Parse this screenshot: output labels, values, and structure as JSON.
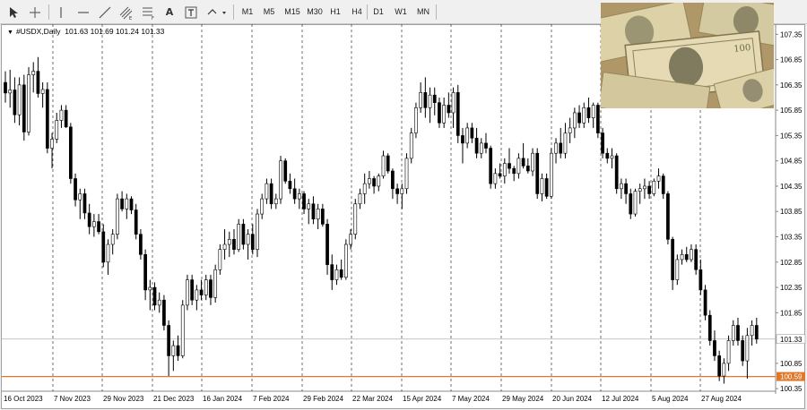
{
  "toolbar": {
    "tools": [
      "cursor-icon",
      "crosshair-icon",
      "vertical-line-icon",
      "horizontal-line-icon",
      "trend-line-icon",
      "channel-icon",
      "fibonacci-icon",
      "text-icon",
      "text-label-icon",
      "arrows-icon"
    ],
    "text_tool_label": "A",
    "timeframes": [
      "M1",
      "M5",
      "M15",
      "M30",
      "H1",
      "H4",
      "D1",
      "W1",
      "MN"
    ]
  },
  "chart_header": {
    "symbol": "#USDX,Daily",
    "ohlc": "101.63 101.69 101.24 101.33"
  },
  "chart_data": {
    "type": "candlestick",
    "symbol": "#USDX",
    "timeframe": "Daily",
    "y_ticks": [
      "107.35",
      "106.85",
      "106.35",
      "105.85",
      "105.35",
      "104.85",
      "104.35",
      "103.85",
      "103.35",
      "102.85",
      "102.35",
      "101.85",
      "101.33",
      "100.85",
      "100.59",
      "100.35"
    ],
    "x_tick_labels": [
      "16 Oct 2023",
      "7 Nov 2023",
      "29 Nov 2023",
      "21 Dec 2023",
      "16 Jan 2024",
      "7 Feb 2024",
      "29 Feb 2024",
      "22 Mar 2024",
      "15 Apr 2024",
      "7 May 2024",
      "29 May 2024",
      "20 Jun 2024",
      "12 Jul 2024",
      "5 Aug 2024",
      "27 Aug 2024"
    ],
    "ylim": [
      100.3,
      107.55
    ],
    "current_price": 101.33,
    "support_level": 100.59,
    "colors": {
      "bull": "#ffffff",
      "bear": "#000000",
      "support": "#e0782a",
      "current": "#b0b0b0",
      "price_tag": "#e0782a"
    },
    "grid": "vertical dashed at date labels",
    "candles": [
      [
        106.4,
        106.62,
        106.0,
        106.19
      ],
      [
        106.19,
        106.65,
        105.9,
        106.25
      ],
      [
        106.25,
        106.5,
        105.6,
        105.76
      ],
      [
        105.76,
        106.5,
        105.55,
        106.35
      ],
      [
        106.35,
        106.55,
        105.25,
        105.42
      ],
      [
        105.42,
        106.7,
        105.35,
        106.55
      ],
      [
        106.55,
        106.8,
        106.2,
        106.62
      ],
      [
        106.62,
        106.9,
        106.1,
        106.18
      ],
      [
        106.18,
        106.4,
        105.9,
        106.26
      ],
      [
        106.26,
        106.4,
        105.0,
        105.1
      ],
      [
        105.1,
        105.4,
        104.7,
        105.28
      ],
      [
        105.28,
        105.8,
        105.2,
        105.65
      ],
      [
        105.65,
        105.95,
        105.5,
        105.85
      ],
      [
        105.85,
        105.95,
        105.5,
        105.52
      ],
      [
        105.52,
        105.6,
        104.4,
        104.5
      ],
      [
        104.5,
        104.6,
        103.95,
        104.08
      ],
      [
        104.08,
        104.3,
        103.7,
        104.2
      ],
      [
        104.2,
        104.3,
        103.7,
        103.82
      ],
      [
        103.82,
        104.0,
        103.4,
        103.55
      ],
      [
        103.55,
        103.8,
        103.35,
        103.65
      ],
      [
        103.65,
        103.8,
        103.4,
        103.45
      ],
      [
        103.45,
        103.6,
        102.75,
        102.85
      ],
      [
        102.85,
        103.3,
        102.6,
        103.2
      ],
      [
        103.2,
        103.5,
        103.0,
        103.4
      ],
      [
        103.4,
        104.2,
        103.3,
        104.1
      ],
      [
        104.1,
        104.25,
        103.85,
        103.9
      ],
      [
        103.9,
        104.2,
        103.7,
        104.1
      ],
      [
        104.1,
        104.15,
        103.8,
        103.88
      ],
      [
        103.88,
        104.0,
        103.3,
        103.4
      ],
      [
        103.4,
        103.5,
        102.9,
        103.0
      ],
      [
        103.0,
        103.1,
        102.1,
        102.3
      ],
      [
        102.3,
        102.5,
        101.9,
        102.35
      ],
      [
        102.35,
        102.45,
        101.9,
        102.0
      ],
      [
        102.0,
        102.25,
        101.85,
        102.1
      ],
      [
        102.1,
        102.2,
        101.5,
        101.6
      ],
      [
        101.6,
        101.7,
        100.6,
        101.0
      ],
      [
        101.0,
        101.3,
        100.7,
        101.2
      ],
      [
        101.2,
        101.4,
        100.9,
        101.0
      ],
      [
        101.0,
        102.1,
        100.95,
        102.0
      ],
      [
        102.0,
        102.6,
        101.9,
        102.5
      ],
      [
        102.5,
        102.6,
        102.0,
        102.1
      ],
      [
        102.1,
        102.4,
        101.9,
        102.3
      ],
      [
        102.3,
        102.5,
        102.1,
        102.2
      ],
      [
        102.2,
        102.6,
        102.1,
        102.5
      ],
      [
        102.5,
        102.6,
        102.0,
        102.15
      ],
      [
        102.15,
        102.8,
        102.05,
        102.7
      ],
      [
        102.7,
        103.2,
        102.6,
        103.1
      ],
      [
        103.1,
        103.5,
        102.9,
        103.2
      ],
      [
        103.2,
        103.45,
        102.95,
        103.3
      ],
      [
        103.3,
        103.5,
        103.0,
        103.1
      ],
      [
        103.1,
        103.7,
        103.05,
        103.6
      ],
      [
        103.6,
        103.7,
        103.1,
        103.2
      ],
      [
        103.2,
        103.5,
        102.9,
        103.4
      ],
      [
        103.4,
        103.6,
        103.0,
        103.1
      ],
      [
        103.1,
        103.9,
        102.95,
        103.8
      ],
      [
        103.8,
        104.2,
        103.7,
        104.1
      ],
      [
        104.1,
        104.5,
        104.0,
        104.4
      ],
      [
        104.4,
        104.5,
        103.9,
        104.0
      ],
      [
        104.0,
        104.2,
        103.9,
        104.1
      ],
      [
        104.1,
        104.95,
        104.0,
        104.85
      ],
      [
        104.85,
        104.9,
        104.4,
        104.45
      ],
      [
        104.45,
        104.6,
        104.2,
        104.3
      ],
      [
        104.3,
        104.5,
        104.0,
        104.1
      ],
      [
        104.1,
        104.3,
        103.9,
        104.2
      ],
      [
        104.2,
        104.25,
        103.8,
        103.9
      ],
      [
        103.9,
        104.1,
        103.6,
        104.0
      ],
      [
        104.0,
        104.15,
        103.6,
        103.7
      ],
      [
        103.7,
        104.0,
        103.5,
        103.9
      ],
      [
        103.9,
        104.0,
        103.55,
        103.6
      ],
      [
        103.6,
        103.7,
        102.6,
        102.8
      ],
      [
        102.8,
        103.0,
        102.3,
        102.5
      ],
      [
        102.5,
        102.8,
        102.4,
        102.7
      ],
      [
        102.7,
        102.9,
        102.5,
        102.55
      ],
      [
        102.55,
        103.3,
        102.5,
        103.2
      ],
      [
        103.2,
        103.5,
        103.1,
        103.4
      ],
      [
        103.4,
        104.1,
        103.3,
        104.0
      ],
      [
        104.0,
        104.3,
        103.9,
        104.2
      ],
      [
        104.2,
        104.6,
        104.0,
        104.4
      ],
      [
        104.4,
        104.65,
        104.3,
        104.5
      ],
      [
        104.5,
        104.55,
        104.2,
        104.35
      ],
      [
        104.35,
        104.6,
        104.25,
        104.55
      ],
      [
        104.55,
        105.05,
        104.5,
        104.95
      ],
      [
        104.95,
        105.0,
        104.6,
        104.65
      ],
      [
        104.65,
        104.7,
        104.1,
        104.3
      ],
      [
        104.3,
        104.4,
        104.0,
        104.2
      ],
      [
        104.2,
        104.4,
        103.9,
        104.3
      ],
      [
        104.3,
        105.0,
        104.2,
        104.9
      ],
      [
        104.9,
        105.5,
        104.8,
        105.4
      ],
      [
        105.4,
        106.0,
        105.3,
        105.9
      ],
      [
        105.9,
        106.4,
        105.8,
        106.2
      ],
      [
        106.2,
        106.5,
        105.7,
        105.9
      ],
      [
        105.9,
        106.3,
        105.6,
        106.15
      ],
      [
        106.15,
        106.3,
        105.75,
        106.0
      ],
      [
        106.0,
        106.1,
        105.5,
        105.6
      ],
      [
        105.6,
        106.1,
        105.5,
        105.95
      ],
      [
        105.95,
        106.2,
        105.7,
        105.8
      ],
      [
        105.8,
        106.3,
        105.5,
        106.2
      ],
      [
        106.2,
        106.35,
        105.2,
        105.35
      ],
      [
        105.35,
        105.5,
        104.8,
        105.2
      ],
      [
        105.2,
        105.6,
        105.1,
        105.5
      ],
      [
        105.5,
        105.6,
        105.2,
        105.3
      ],
      [
        105.3,
        105.5,
        104.9,
        105.0
      ],
      [
        105.0,
        105.3,
        104.9,
        105.2
      ],
      [
        105.2,
        105.4,
        105.0,
        105.1
      ],
      [
        105.1,
        105.15,
        104.3,
        104.4
      ],
      [
        104.4,
        104.7,
        104.3,
        104.6
      ],
      [
        104.6,
        104.8,
        104.5,
        104.55
      ],
      [
        104.55,
        104.9,
        104.4,
        104.8
      ],
      [
        104.8,
        105.1,
        104.6,
        104.7
      ],
      [
        104.7,
        104.75,
        104.45,
        104.6
      ],
      [
        104.6,
        105.0,
        104.5,
        104.9
      ],
      [
        104.9,
        105.2,
        104.7,
        104.75
      ],
      [
        104.75,
        104.9,
        104.6,
        104.65
      ],
      [
        104.65,
        105.1,
        104.55,
        105.0
      ],
      [
        105.0,
        105.1,
        104.1,
        104.2
      ],
      [
        104.2,
        104.6,
        104.05,
        104.5
      ],
      [
        104.5,
        104.6,
        104.1,
        104.15
      ],
      [
        104.15,
        105.1,
        104.1,
        105.0
      ],
      [
        105.0,
        105.3,
        104.8,
        105.2
      ],
      [
        105.2,
        105.5,
        104.9,
        105.0
      ],
      [
        105.0,
        105.6,
        104.9,
        105.4
      ],
      [
        105.4,
        105.7,
        105.2,
        105.5
      ],
      [
        105.5,
        105.9,
        105.3,
        105.8
      ],
      [
        105.8,
        105.95,
        105.5,
        105.6
      ],
      [
        105.6,
        106.0,
        105.5,
        105.9
      ],
      [
        105.9,
        106.1,
        105.6,
        105.7
      ],
      [
        105.7,
        106.0,
        105.5,
        105.95
      ],
      [
        105.95,
        106.0,
        105.3,
        105.4
      ],
      [
        105.4,
        105.5,
        104.9,
        105.0
      ],
      [
        105.0,
        105.1,
        104.8,
        104.9
      ],
      [
        104.9,
        105.1,
        104.7,
        104.95
      ],
      [
        104.95,
        105.0,
        104.2,
        104.3
      ],
      [
        104.3,
        104.5,
        104.1,
        104.4
      ],
      [
        104.4,
        104.5,
        104.0,
        104.2
      ],
      [
        104.2,
        104.3,
        103.7,
        103.8
      ],
      [
        103.8,
        104.3,
        103.75,
        104.25
      ],
      [
        104.25,
        104.4,
        104.0,
        104.3
      ],
      [
        104.3,
        104.5,
        104.1,
        104.35
      ],
      [
        104.35,
        104.45,
        104.1,
        104.2
      ],
      [
        104.2,
        104.5,
        104.15,
        104.45
      ],
      [
        104.45,
        104.7,
        104.3,
        104.55
      ],
      [
        104.55,
        104.6,
        104.1,
        104.2
      ],
      [
        104.2,
        104.25,
        103.2,
        103.3
      ],
      [
        103.3,
        103.35,
        102.3,
        102.5
      ],
      [
        102.5,
        103.0,
        102.4,
        102.9
      ],
      [
        102.9,
        103.1,
        102.8,
        103.0
      ],
      [
        103.0,
        103.15,
        102.85,
        102.9
      ],
      [
        102.9,
        103.2,
        102.85,
        103.1
      ],
      [
        103.1,
        103.2,
        102.6,
        102.7
      ],
      [
        102.7,
        102.9,
        102.2,
        102.3
      ],
      [
        102.3,
        102.4,
        101.7,
        101.8
      ],
      [
        101.8,
        101.9,
        101.2,
        101.3
      ],
      [
        101.3,
        101.5,
        100.9,
        101.0
      ],
      [
        101.0,
        101.1,
        100.5,
        100.6
      ],
      [
        100.6,
        100.95,
        100.45,
        100.85
      ],
      [
        100.85,
        101.4,
        100.7,
        101.3
      ],
      [
        101.3,
        101.7,
        101.2,
        101.6
      ],
      [
        101.6,
        101.75,
        101.2,
        101.3
      ],
      [
        101.3,
        101.4,
        100.8,
        100.9
      ],
      [
        100.9,
        101.55,
        100.55,
        101.4
      ],
      [
        101.4,
        101.7,
        101.2,
        101.6
      ],
      [
        101.6,
        101.75,
        101.24,
        101.33
      ]
    ]
  }
}
